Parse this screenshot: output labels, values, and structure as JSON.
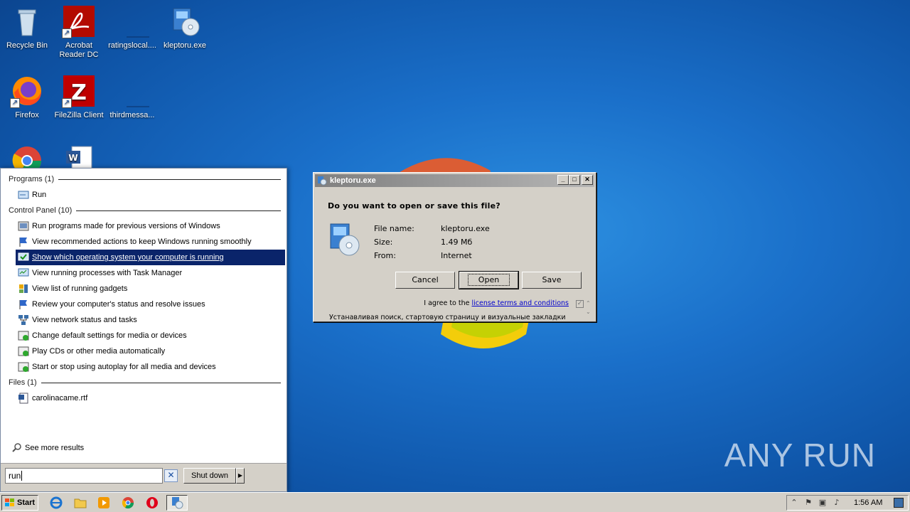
{
  "desktop": {
    "icons": [
      {
        "label": "Recycle Bin"
      },
      {
        "label": "Acrobat\nReader DC"
      },
      {
        "label": "ratingslocal...."
      },
      {
        "label": "kleptoru.exe"
      },
      {
        "label": "Firefox"
      },
      {
        "label": "FileZilla Client"
      },
      {
        "label": "thirdmessa..."
      }
    ],
    "watermark": "ANY RUN"
  },
  "start_menu": {
    "sections": {
      "programs": "Programs (1)",
      "control_panel": "Control Panel (10)",
      "files": "Files (1)"
    },
    "program_items": [
      "Run"
    ],
    "control_panel_items": [
      "Run programs made for previous versions of Windows",
      "View recommended actions to keep Windows running smoothly",
      "Show which operating system your computer is running",
      "View running processes with Task Manager",
      "View list of running gadgets",
      "Review your computer's status and resolve issues",
      "View network status and tasks",
      "Change default settings for media or devices",
      "Play CDs or other media automatically",
      "Start or stop using autoplay for all media and devices"
    ],
    "selected_item": "Show which operating system your computer is running",
    "file_items": [
      "carolinacame.rtf"
    ],
    "see_more": "See more results",
    "search_value": "run",
    "shutdown_label": "Shut down"
  },
  "dialog": {
    "title": "kleptoru.exe",
    "question": "Do you want to open or save this file?",
    "file_name_label": "File name:",
    "file_name": "kleptoru.exe",
    "size_label": "Size:",
    "size": "1.49 Мб",
    "from_label": "From:",
    "from": "Internet",
    "cancel_label": "Cancel",
    "open_label": "Open",
    "save_label": "Save",
    "agree_prefix": "I agree to the",
    "agree_link": "license terms and conditions",
    "russian_line": "Устанавливая поиск, стартовую страницу и визуальные закладки"
  },
  "taskbar": {
    "start_label": "Start",
    "clock": "1:56 AM"
  }
}
